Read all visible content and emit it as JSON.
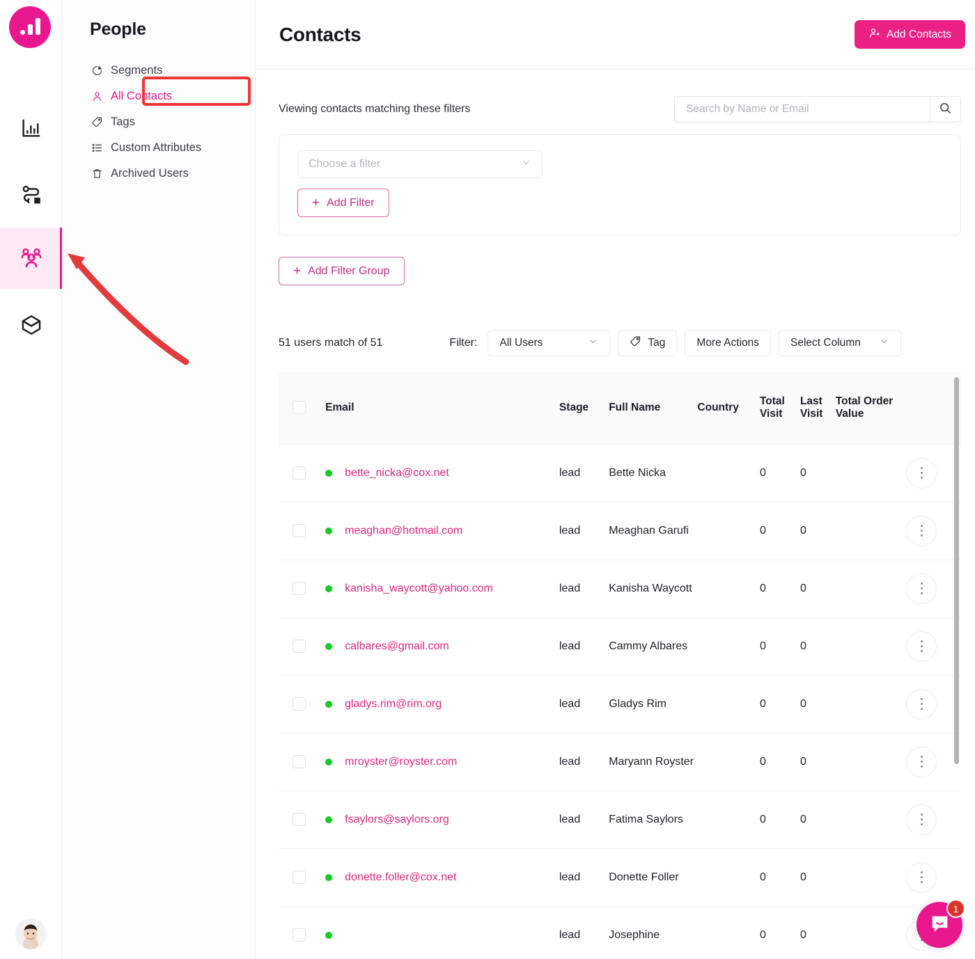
{
  "brand": {
    "primary": "#e9178d",
    "accent_red": "#ef3434",
    "status_green": "#15cb28",
    "logo_name": "bar-chart-logo"
  },
  "rail": {
    "items": [
      {
        "name": "analytics-icon",
        "label": "Analytics",
        "active": false
      },
      {
        "name": "journeys-icon",
        "label": "Journeys",
        "active": false
      },
      {
        "name": "people-icon",
        "label": "People",
        "active": true
      },
      {
        "name": "products-icon",
        "label": "Products",
        "active": false
      }
    ],
    "avatar_alt": "User avatar"
  },
  "sidebar": {
    "title": "People",
    "items": [
      {
        "label": "Segments",
        "icon": "pie-chart-icon",
        "selected": false
      },
      {
        "label": "All Contacts",
        "icon": "person-icon",
        "selected": true
      },
      {
        "label": "Tags",
        "icon": "tag-icon",
        "selected": false
      },
      {
        "label": "Custom Attributes",
        "icon": "list-icon",
        "selected": false
      },
      {
        "label": "Archived Users",
        "icon": "trash-icon",
        "selected": false
      }
    ]
  },
  "header": {
    "title": "Contacts",
    "add_contacts_label": "Add Contacts",
    "add_contacts_icon": "person-plus-icon"
  },
  "filters": {
    "description": "Viewing contacts matching these filters",
    "search_placeholder": "Search by Name or Email",
    "search_value": "",
    "search_icon": "search-icon",
    "choose_filter_placeholder": "Choose a filter",
    "choose_filter_value": "",
    "add_filter_label": "Add Filter",
    "add_filter_group_label": "Add Filter Group",
    "plus_symbol": "+"
  },
  "toolbar": {
    "match_count": "51 users match of 51",
    "filter_label": "Filter:",
    "filter_value": "All Users",
    "tag_label": "Tag",
    "tag_icon": "tag-icon",
    "more_actions_label": "More Actions",
    "select_column_label": "Select Column"
  },
  "table": {
    "columns": [
      "Email",
      "Stage",
      "Full Name",
      "Country",
      "Total Visit",
      "Last Visit",
      "Total Order Value"
    ],
    "rows": [
      {
        "email": "bette_nicka@cox.net",
        "stage": "lead",
        "full_name": "Bette Nicka",
        "country": "",
        "total_visit": "0",
        "last_visit": "0",
        "total_order_value": "",
        "status": "online"
      },
      {
        "email": "meaghan@hotmail.com",
        "stage": "lead",
        "full_name": "Meaghan Garufi",
        "country": "",
        "total_visit": "0",
        "last_visit": "0",
        "total_order_value": "",
        "status": "online"
      },
      {
        "email": "kanisha_waycott@yahoo.com",
        "stage": "lead",
        "full_name": "Kanisha Waycott",
        "country": "",
        "total_visit": "0",
        "last_visit": "0",
        "total_order_value": "",
        "status": "online"
      },
      {
        "email": "calbares@gmail.com",
        "stage": "lead",
        "full_name": "Cammy Albares",
        "country": "",
        "total_visit": "0",
        "last_visit": "0",
        "total_order_value": "",
        "status": "online"
      },
      {
        "email": "gladys.rim@rim.org",
        "stage": "lead",
        "full_name": "Gladys Rim",
        "country": "",
        "total_visit": "0",
        "last_visit": "0",
        "total_order_value": "",
        "status": "online"
      },
      {
        "email": "mroyster@royster.com",
        "stage": "lead",
        "full_name": "Maryann Royster",
        "country": "",
        "total_visit": "0",
        "last_visit": "0",
        "total_order_value": "",
        "status": "online"
      },
      {
        "email": "fsaylors@saylors.org",
        "stage": "lead",
        "full_name": "Fatima Saylors",
        "country": "",
        "total_visit": "0",
        "last_visit": "0",
        "total_order_value": "",
        "status": "online"
      },
      {
        "email": "donette.foller@cox.net",
        "stage": "lead",
        "full_name": "Donette Foller",
        "country": "",
        "total_visit": "0",
        "last_visit": "0",
        "total_order_value": "",
        "status": "online"
      },
      {
        "email": "",
        "stage": "lead",
        "full_name": "Josephine",
        "country": "",
        "total_visit": "0",
        "last_visit": "0",
        "total_order_value": "",
        "status": "online"
      }
    ]
  },
  "intercom": {
    "badge_count": "1",
    "icon": "chat-bubble-icon"
  },
  "annotation": {
    "arrow_name": "red-arrow-pointing-to-people-icon",
    "highlight_name": "red-highlight-all-contacts"
  }
}
